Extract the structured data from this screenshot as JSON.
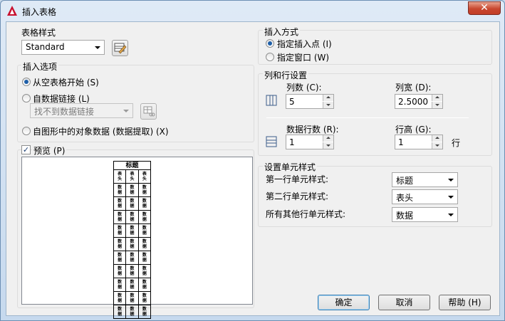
{
  "window": {
    "title": "插入表格",
    "close": "✕"
  },
  "table_style": {
    "label": "表格样式",
    "value": "Standard"
  },
  "insert_options": {
    "label": "插入选项",
    "from_empty": "从空表格开始 (S)",
    "from_link": "自数据链接 (L)",
    "link_value": "找不到数据链接",
    "from_objects": "自图形中的对象数据 (数据提取) (X)"
  },
  "preview": {
    "label": "预览 (P)",
    "checked": true,
    "title": "标题",
    "header": [
      "表头",
      "表头",
      "表头"
    ],
    "cell": "数据",
    "data_rows": 10
  },
  "insertion": {
    "label": "插入方式",
    "point": "指定插入点 (I)",
    "window": "指定窗口 (W)"
  },
  "col_row": {
    "label": "列和行设置",
    "columns_label": "列数 (C):",
    "columns": "5",
    "col_width_label": "列宽 (D):",
    "col_width": "2.5000",
    "rows_label": "数据行数 (R):",
    "rows": "1",
    "row_height_label": "行高 (G):",
    "row_height": "1",
    "row_unit": "行"
  },
  "cell_styles": {
    "label": "设置单元样式",
    "first_label": "第一行单元样式:",
    "first": "标题",
    "second_label": "第二行单元样式:",
    "second": "表头",
    "other_label": "所有其他行单元样式:",
    "other": "数据"
  },
  "buttons": {
    "ok": "确定",
    "cancel": "取消",
    "help": "帮助 (H)"
  }
}
